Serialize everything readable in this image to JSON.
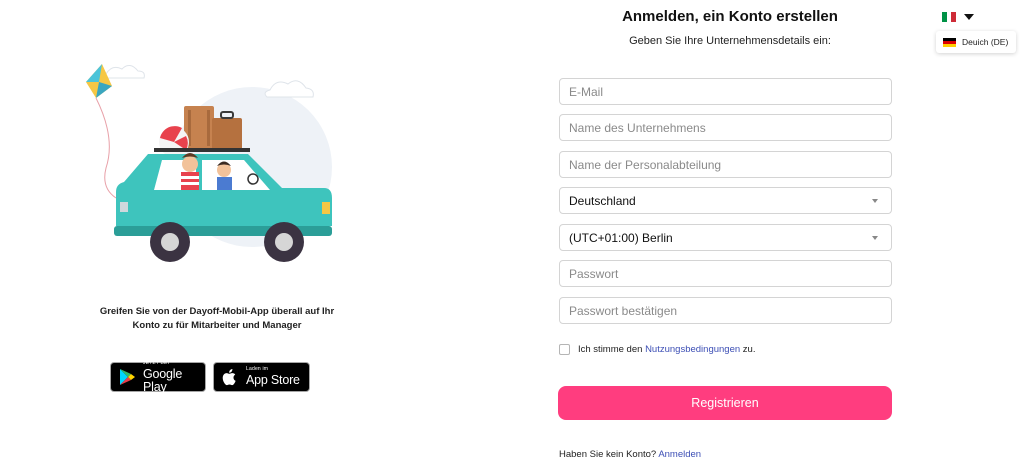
{
  "header": {
    "title": "Anmelden, ein Konto erstellen",
    "subtitle": "Geben Sie Ihre Unternehmensdetails ein:"
  },
  "language": {
    "current_flag": "italy-flag-icon",
    "menu_item_label": "Deuich (DE)",
    "menu_item_flag": "germany-flag-icon"
  },
  "promo": {
    "text": "Greifen Sie von der Dayoff-Mobil-App überall auf Ihr Konto zu für Mitarbeiter und Manager",
    "google": {
      "small": "JETZT BEI",
      "big": "Google Play"
    },
    "apple": {
      "small": "Laden im",
      "big": "App Store"
    }
  },
  "form": {
    "email_placeholder": "E-Mail",
    "company_placeholder": "Name des Unternehmens",
    "hr_placeholder": "Name der Personalabteilung",
    "country_value": "Deutschland",
    "timezone_value": "(UTC+01:00) Berlin",
    "password_placeholder": "Passwort",
    "password_confirm_placeholder": "Passwort bestätigen",
    "terms_prefix": "Ich stimme den",
    "terms_link": "Nutzungsbedingungen",
    "terms_suffix": "zu.",
    "register_label": "Registrieren"
  },
  "footer": {
    "no_account": "Haben Sie kein Konto?",
    "login_link": "Anmelden"
  },
  "colors": {
    "accent": "#ff3d7f",
    "link": "#3d4fb5",
    "car": "#3ec4bd"
  }
}
